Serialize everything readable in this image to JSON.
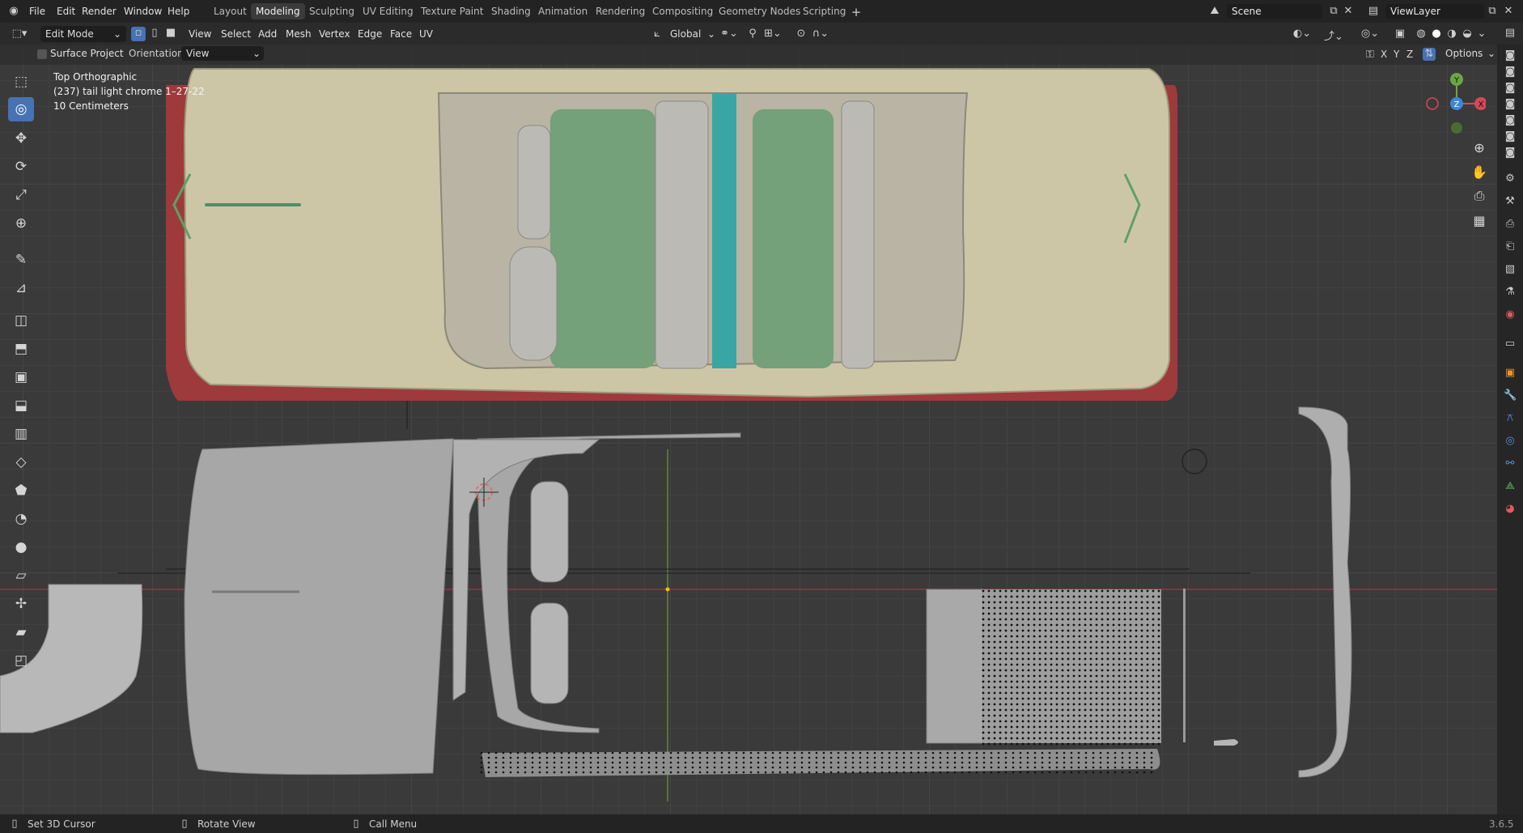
{
  "app": {
    "version": "3.6.5"
  },
  "menu": [
    "File",
    "Edit",
    "Render",
    "Window",
    "Help"
  ],
  "workspaces": [
    "Layout",
    "Modeling",
    "Sculpting",
    "UV Editing",
    "Texture Paint",
    "Shading",
    "Animation",
    "Rendering",
    "Compositing",
    "Geometry Nodes",
    "Scripting"
  ],
  "active_workspace": "Modeling",
  "scene": {
    "name": "Scene"
  },
  "view_layer": {
    "name": "ViewLayer"
  },
  "header": {
    "mode": "Edit Mode",
    "menus": [
      "View",
      "Select",
      "Add",
      "Mesh",
      "Vertex",
      "Edge",
      "Face",
      "UV"
    ],
    "transform_orientation": "Global"
  },
  "tool_options": {
    "surface_project_label": "Surface Project",
    "orientation_label": "Orientation:",
    "orientation_value": "View",
    "options_label": "Options",
    "axis_labels": [
      "X",
      "Y",
      "Z"
    ]
  },
  "overlay": {
    "view_name": "Top Orthographic",
    "object_info": "(237) tail light chrome 1–27-22",
    "scale": "10 Centimeters"
  },
  "gizmo": {
    "axes": [
      "Y",
      "Z",
      "X"
    ]
  },
  "toolbar": {
    "tools": [
      "select-box-tool",
      "cursor-tool",
      "move-tool",
      "rotate-tool",
      "scale-tool",
      "transform-tool",
      "annotate-tool",
      "measure-tool",
      "add-cube-tool",
      "extrude-tool",
      "inset-tool",
      "bevel-tool",
      "loop-cut-tool",
      "knife-tool",
      "poly-build-tool",
      "spin-tool",
      "smooth-tool",
      "edge-slide-tool",
      "shrink-fatten-tool",
      "shear-tool",
      "rip-tool"
    ],
    "active_index": 1
  },
  "status": {
    "left": "Set 3D Cursor",
    "middle": "Rotate View",
    "right": "Call Menu"
  },
  "colors": {
    "accent": "#4772b3",
    "car_body": "#cdc6a6",
    "car_red": "#a33b3b",
    "seat_green": "#74a07a",
    "teal": "#3aa6a3",
    "mesh_gray": "#a7a7a7"
  }
}
